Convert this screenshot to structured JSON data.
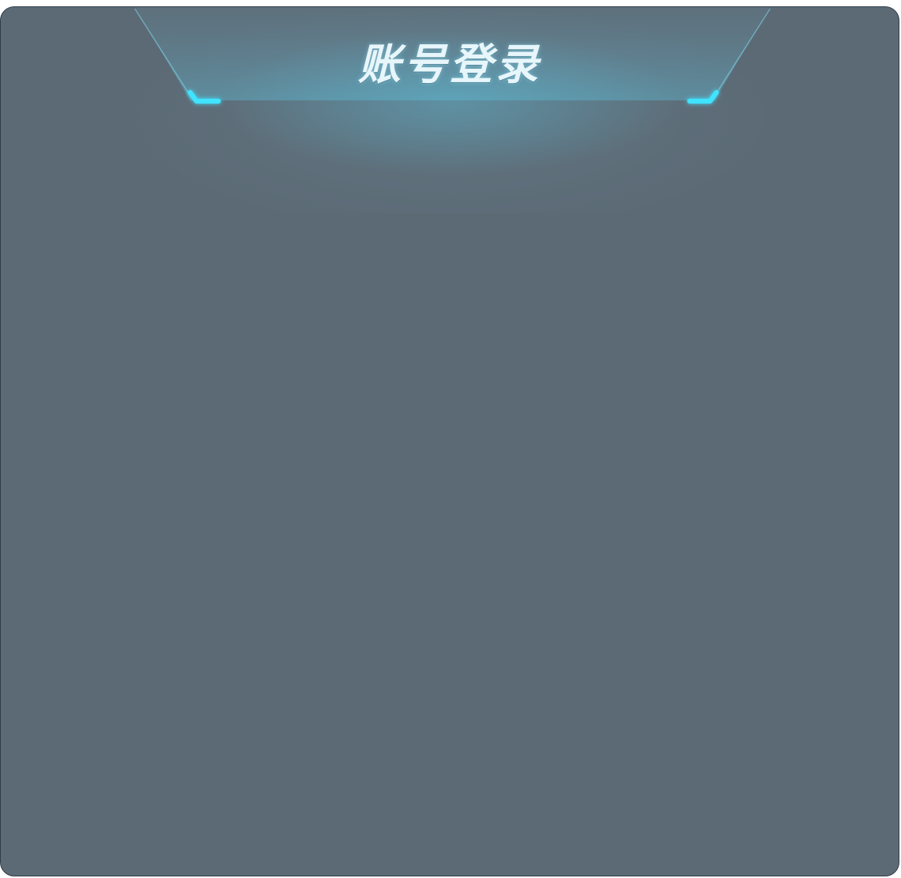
{
  "dialog": {
    "title": "账号登录"
  },
  "colors": {
    "panel_background": "#5c6a75",
    "panel_border": "#2f3d4a",
    "accent_glow": "#3fd9f5",
    "title_text": "#e7f6fb"
  }
}
